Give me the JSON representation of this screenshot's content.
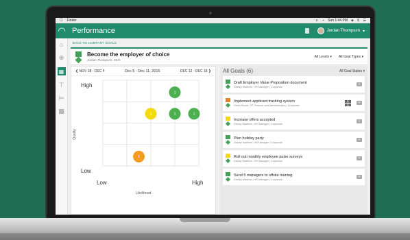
{
  "menubar": {
    "app_name": "Finder",
    "clock": "Sun 1:44 PM"
  },
  "appbar": {
    "title": "Performance",
    "user_name": "Jordan Thompson"
  },
  "breadcrumb": {
    "back_label": "BACK TO COMPANY GOALS"
  },
  "goal_header": {
    "title": "Become the employer of choice",
    "owner": "Jordan Thompson, CEO",
    "level_filter": "All Levels",
    "type_filter": "All Goal Types"
  },
  "week_nav": {
    "prev": "NOV 28 - DEC 4",
    "current": "Dec 5 - Dec 11, 2016",
    "next": "DEC 12 - DEC 18"
  },
  "chart_data": {
    "type": "scatter",
    "xlabel": "Likelihood",
    "ylabel": "Quality",
    "x_low": "Low",
    "x_high": "High",
    "y_low": "Low",
    "y_high": "High",
    "grid": "3x3",
    "points": [
      {
        "col": 3,
        "row": 1,
        "label": "1",
        "color": "#4caf50"
      },
      {
        "col": 2,
        "row": 2,
        "label": "1",
        "color": "#f5d90a"
      },
      {
        "col": 3,
        "row": 2,
        "label": "1",
        "color": "#4caf50"
      },
      {
        "col": 3.8,
        "row": 2,
        "label": "1",
        "color": "#4caf50"
      },
      {
        "col": 1.5,
        "row": 4,
        "label": "1",
        "color": "#f39c1f"
      }
    ]
  },
  "goals_panel": {
    "title": "All Goals (6)",
    "state_filter": "All Goal States",
    "items": [
      {
        "title": "Draft Employer Value Proposition document",
        "sub": "Dewey Martinez, HR Manager | Corporate",
        "color": "#45a05a",
        "grid": false
      },
      {
        "title": "Implement applicant tracking system",
        "sub": "Helen Beard, VP, Finance and Administration | Corporate",
        "color": "#e8822a",
        "grid": true
      },
      {
        "title": "Increase offers accepted",
        "sub": "Dewey Martinez, HR Manager | Corporate",
        "color": "#f5d90a",
        "grid": false
      },
      {
        "title": "Plan holiday party",
        "sub": "Dewey Martinez, HR Manager | Corporate",
        "color": "#45a05a",
        "grid": false
      },
      {
        "title": "Roll out monthly employee pulse surveys",
        "sub": "Dewey Martinez, HR Manager | Corporate",
        "color": "#f5d90a",
        "grid": false
      },
      {
        "title": "Send 5 managers to offsite training",
        "sub": "Dewey Martinez, HR Manager | Corporate",
        "color": "#45a05a",
        "grid": false
      }
    ]
  }
}
